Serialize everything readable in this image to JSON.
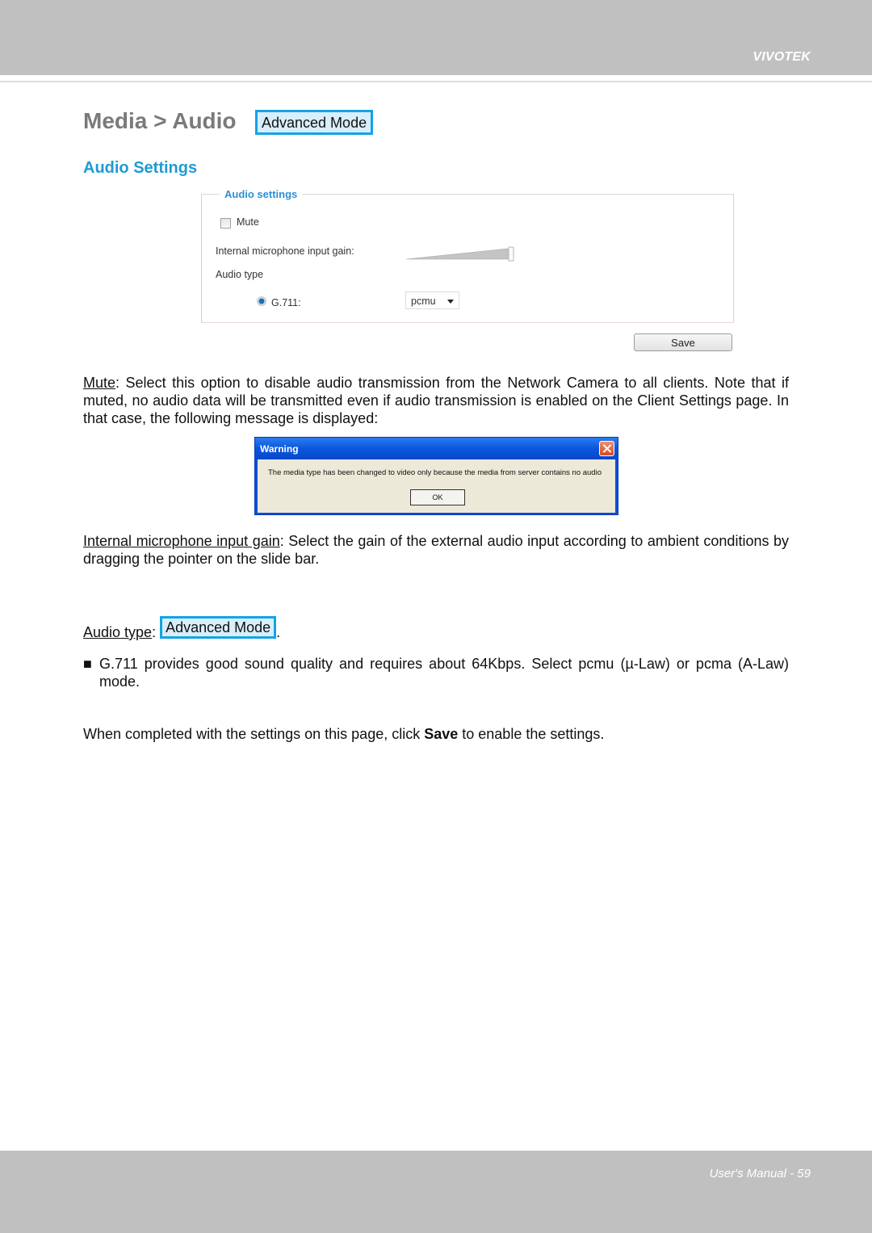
{
  "header": {
    "brand": "VIVOTEK"
  },
  "page": {
    "title": "Media > Audio",
    "title_badge": "Advanced Mode",
    "section_title": "Audio Settings"
  },
  "audio_settings_panel": {
    "legend": "Audio settings",
    "mute": {
      "label": "Mute",
      "checked": false
    },
    "gain": {
      "label": "Internal microphone input gain:",
      "value_fraction": 1.0
    },
    "audio_type_label": "Audio type",
    "codec": {
      "label": "G.711:",
      "selected": true
    },
    "codec_select": {
      "value": "pcmu"
    },
    "save_label": "Save"
  },
  "paragraphs": {
    "mute": {
      "term": "Mute",
      "text": ": Select this option to disable audio transmission from the Network Camera to all clients. Note that if muted, no audio data will be transmitted even if audio transmission is enabled on the Client Settings page. In that case, the following message is displayed:"
    },
    "gain": {
      "term": "Internal microphone input gain",
      "text": ": Select the gain of the external audio input according to ambient conditions by dragging the pointer on the slide bar."
    },
    "audio_type": {
      "term": "Audio type",
      "sep": ": ",
      "badge": "Advanced Mode",
      "end": "."
    },
    "g711": {
      "bullet": "■",
      "text": "G.711 provides good sound quality and requires about 64Kbps. Select pcmu (µ-Law) or pcma (A-Law) mode."
    },
    "save": {
      "before": "When completed with the settings on this page, click ",
      "bold": "Save",
      "after": " to enable the settings."
    }
  },
  "warning_dialog": {
    "title": "Warning",
    "message": "The media type has been changed to video only because the media from server contains no audio",
    "ok_label": "OK"
  },
  "footer": {
    "text": "User's Manual - 59"
  }
}
